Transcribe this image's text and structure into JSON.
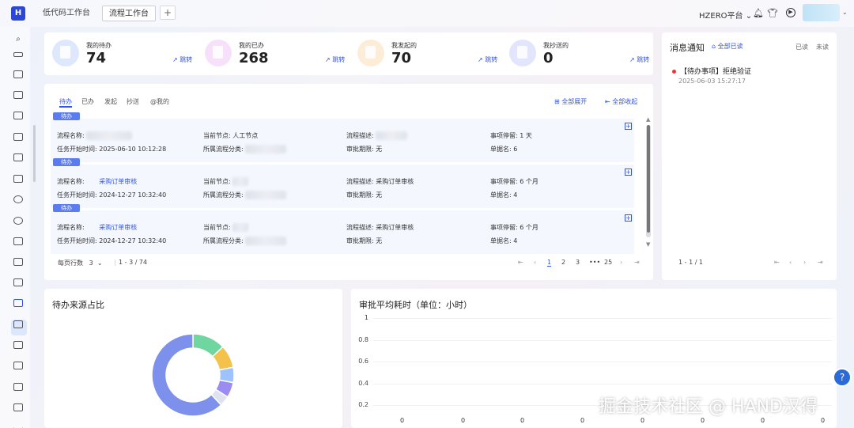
{
  "topbar": {
    "logo": "H",
    "tabs": [
      {
        "label": "低代码工作台"
      },
      {
        "label": "流程工作台"
      }
    ],
    "add_tab": "+",
    "platform": "HZERO平台",
    "platform_caret": "⌄",
    "avatar_caret": "⌄"
  },
  "stats": [
    {
      "label": "我的待办",
      "value": "74",
      "jump": "↗ 跳转",
      "color": "#5a8cf5"
    },
    {
      "label": "我的已办",
      "value": "268",
      "jump": "↗ 跳转",
      "color": "#d565e6"
    },
    {
      "label": "我发起的",
      "value": "70",
      "jump": "↗ 跳转",
      "color": "#f6a23b"
    },
    {
      "label": "我抄送的",
      "value": "0",
      "jump": "↗ 跳转",
      "color": "#6f7ff0"
    }
  ],
  "filters": [
    "待办",
    "已办",
    "发起",
    "抄送",
    "@我的"
  ],
  "expand_all": "全部展开",
  "collapse_all": "全部收起",
  "tasks": [
    {
      "badge": "待办",
      "name_label": "流程名称:",
      "name": "",
      "node_label": "当前节点:",
      "node": "人工节点",
      "desc_label": "流程描述:",
      "stay_label": "事项停留:",
      "stay": "1 天",
      "start_label": "任务开始时间:",
      "start": "2025-06-10 10:12:28",
      "cat_label": "所属流程分类:",
      "deadline_label": "审批期限:",
      "deadline": "无",
      "docname_label": "单据名:",
      "docname": "6"
    },
    {
      "badge": "待办",
      "name_label": "流程名称:",
      "name": "采购订单审核",
      "node_label": "当前节点:",
      "node": "",
      "desc_label": "流程描述:",
      "desc": "采购订单审核",
      "stay_label": "事项停留:",
      "stay": "6 个月",
      "start_label": "任务开始时间:",
      "start": "2024-12-27 10:32:40",
      "cat_label": "所属流程分类:",
      "deadline_label": "审批期限:",
      "deadline": "无",
      "docname_label": "单据名:",
      "docname": "4"
    },
    {
      "badge": "待办",
      "name_label": "流程名称:",
      "name": "采购订单审核",
      "node_label": "当前节点:",
      "node": "",
      "desc_label": "流程描述:",
      "desc": "采购订单审核",
      "stay_label": "事项停留:",
      "stay": "6 个月",
      "start_label": "任务开始时间:",
      "start": "2024-12-27 10:32:40",
      "cat_label": "所属流程分类:",
      "deadline_label": "审批期限:",
      "deadline": "无",
      "docname_label": "单据名:",
      "docname": "4"
    }
  ],
  "pagination": {
    "page_size_label": "每页行数",
    "page_size": "3",
    "range": "1 - 3 / 74",
    "pages": [
      "1",
      "2",
      "3",
      "•••",
      "25"
    ],
    "current": "1"
  },
  "messages": {
    "title": "消息通知",
    "mark_read": "全部已读",
    "filter_read": "已读",
    "filter_unread": "未读",
    "items": [
      {
        "text": "【待办事项】拒绝验证",
        "time": "2025-06-03 15:27:17"
      }
    ],
    "range": "1 - 1 / 1"
  },
  "chart_pie": {
    "title": "待办来源占比"
  },
  "chart_bar": {
    "title": "审批平均耗时（单位：小时）"
  },
  "chart_data": [
    {
      "type": "pie",
      "title": "待办来源占比",
      "slices": [
        {
          "value": 13,
          "color": "#6fd6a0"
        },
        {
          "value": 9,
          "color": "#f4c14a"
        },
        {
          "value": 6,
          "color": "#9ec2ff"
        },
        {
          "value": 6,
          "color": "#9b8cf2"
        },
        {
          "value": 4,
          "color": "#dfe3f0"
        },
        {
          "value": 62,
          "color": "#7d90ec"
        }
      ]
    },
    {
      "type": "bar",
      "title": "审批平均耗时（单位：小时）",
      "yticks": [
        "1",
        "0.8",
        "0.6",
        "0.4",
        "0.2"
      ],
      "ylim": [
        0,
        1
      ],
      "values": [
        0,
        0,
        0,
        0,
        0,
        0,
        0,
        0
      ]
    }
  ],
  "watermark": "掘金技术社区 @ HAND汉得",
  "help_icon": "?"
}
